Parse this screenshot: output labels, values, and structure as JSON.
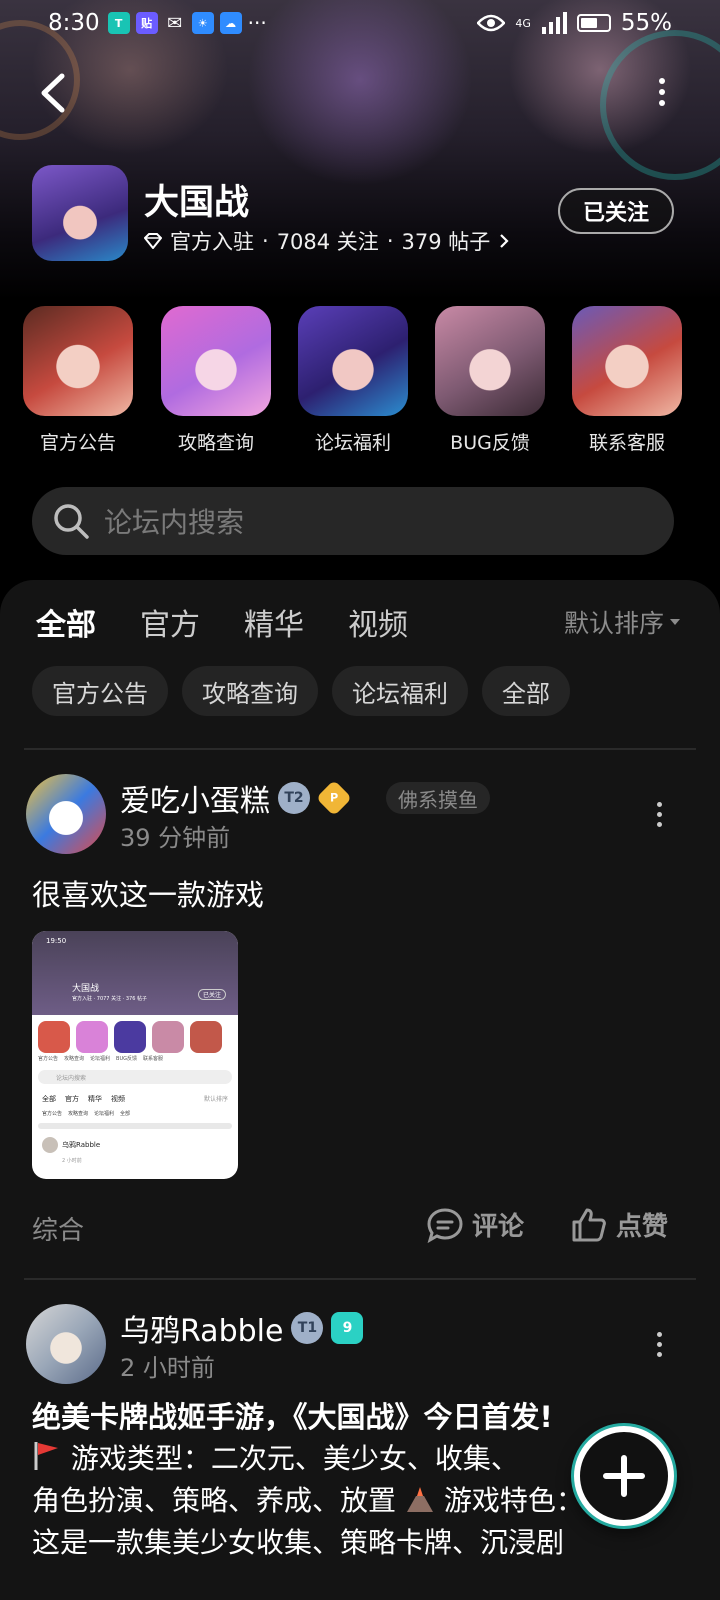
{
  "status_bar": {
    "time": "8:30",
    "network": "4G",
    "battery": "55%"
  },
  "forum": {
    "name": "大国战",
    "verified": "官方入驻",
    "followers": "7084 关注",
    "posts": "379 帖子",
    "separator": "·",
    "follow_label": "已关注"
  },
  "quick_entries": [
    {
      "label": "官方公告"
    },
    {
      "label": "攻略查询"
    },
    {
      "label": "论坛福利"
    },
    {
      "label": "BUG反馈"
    },
    {
      "label": "联系客服"
    }
  ],
  "search": {
    "placeholder": "论坛内搜索"
  },
  "tabs": [
    {
      "label": "全部"
    },
    {
      "label": "官方"
    },
    {
      "label": "精华"
    },
    {
      "label": "视频"
    }
  ],
  "sort_label": "默认排序",
  "chips": [
    {
      "label": "官方公告"
    },
    {
      "label": "攻略查询"
    },
    {
      "label": "论坛福利"
    },
    {
      "label": "全部"
    }
  ],
  "posts": [
    {
      "user": "爱吃小蛋糕",
      "tag": "佛系摸鱼",
      "time": "39 分钟前",
      "text": "很喜欢这一款游戏",
      "category": "综合",
      "comment_label": "评论",
      "like_label": "点赞",
      "screenshot": {
        "time": "19:50",
        "title": "大国战",
        "meta": "官方入驻 · 7077 关注 · 376 帖子",
        "follow": "已关注",
        "labels": [
          "官方公告",
          "攻略查询",
          "论坛福利",
          "BUG反馈",
          "联系客服"
        ],
        "search": "论坛内搜索",
        "tabs": [
          "全部",
          "官方",
          "精华",
          "视频"
        ],
        "sort": "默认排序",
        "chips": [
          "官方公告",
          "攻略查询",
          "论坛福利",
          "全部"
        ],
        "user": "乌鸦Rabble",
        "user_time": "2 小时前"
      }
    },
    {
      "user": "乌鸦Rabble",
      "time": "2 小时前",
      "title": "绝美卡牌战姬手游，《大国战》今日首发!",
      "line1": "游戏类型：二次元、美少女、收集、",
      "line2": "角色扮演、策略、养成、放置 ",
      "line2_tail": "游戏特色：",
      "line3": "这是一款集美少女收集、策略卡牌、沉浸剧"
    }
  ],
  "colors": {
    "accent": "#2bd1c4",
    "panel": "#141414",
    "chip": "#242424"
  }
}
